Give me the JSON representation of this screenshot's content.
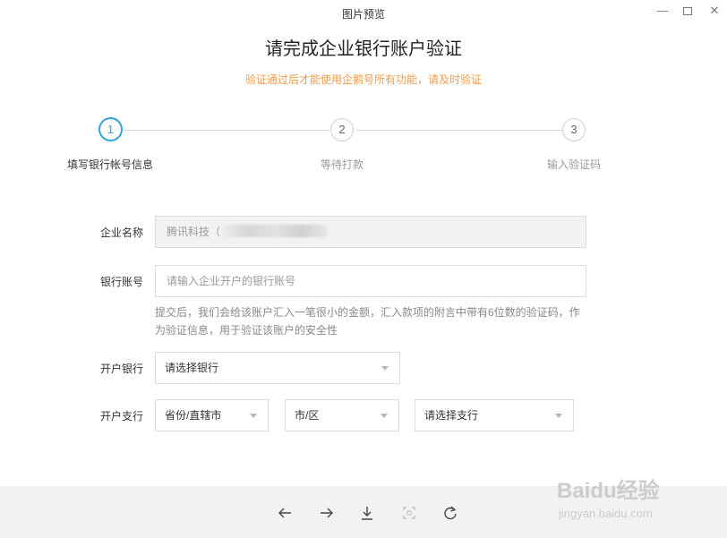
{
  "window": {
    "title": "图片预览",
    "minimize": "—",
    "close": "✕"
  },
  "page": {
    "title": "请完成企业银行账户验证",
    "subtitle": "验证通过后才能使用企鹅号所有功能，请及时验证"
  },
  "steps": [
    {
      "number": "1",
      "label": "填写银行帐号信息",
      "active": true
    },
    {
      "number": "2",
      "label": "等待打款",
      "active": false
    },
    {
      "number": "3",
      "label": "输入验证码",
      "active": false
    }
  ],
  "form": {
    "company_name": {
      "label": "企业名称",
      "value": "腾讯科技（"
    },
    "bank_account": {
      "label": "银行账号",
      "placeholder": "请输入企业开户的银行账号"
    },
    "hint": "提交后，我们会给该账户汇入一笔很小的金额，汇入款项的附言中带有6位数的验证码，作为验证信息，用于验证该账户的安全性",
    "bank": {
      "label": "开户银行",
      "selected": "请选择银行"
    },
    "branch": {
      "label": "开户支行",
      "province": "省份/直辖市",
      "city": "市/区",
      "branch": "请选择支行"
    }
  },
  "toolbar": {
    "icons": [
      "arrow-left-icon",
      "arrow-right-icon",
      "download-icon",
      "fit-screen-icon",
      "rotate-icon"
    ]
  },
  "watermark": {
    "main": "Baidu经验",
    "sub": "jingyan.baidu.com"
  },
  "colors": {
    "accent": "#33a3dc",
    "warning_text": "#f29b4c"
  }
}
